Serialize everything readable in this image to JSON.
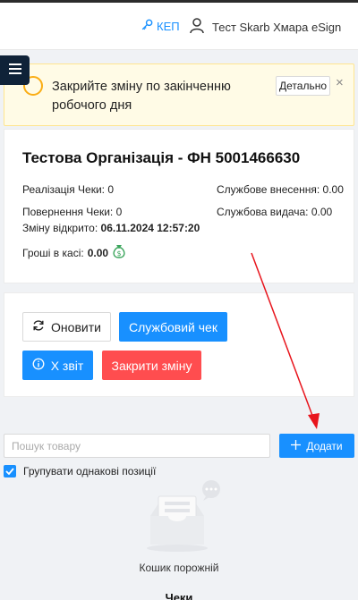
{
  "header": {
    "kep_label": "КЕП",
    "user_name": "Тест Skarb Хмара eSign"
  },
  "alert": {
    "message": "Закрийте зміну по закінченню робочого дня",
    "details_label": "Детально",
    "close_symbol": "×"
  },
  "shift": {
    "title": "Тестова Організація - ФН 5001466630",
    "sales_label": "Реалізація Чеки: 0",
    "returns_label": "Повернення Чеки: 0",
    "service_in_label": "Службове внесення: 0.00",
    "service_out_label": "Службова видача: 0.00",
    "opened_label": "Зміну відкрито:",
    "opened_value": "06.11.2024 12:57:20",
    "cash_label": "Гроші в касі:",
    "cash_value": "0.00"
  },
  "actions": {
    "refresh_label": "Оновити",
    "service_check_label": "Службовий чек",
    "x_report_label": "X звіт",
    "close_shift_label": "Закрити зміну"
  },
  "cart": {
    "search_placeholder": "Пошук товару",
    "add_label": "Додати",
    "group_label": "Групувати однакові позиції",
    "empty_label": "Кошик порожній",
    "bottom_label": "Чеки"
  },
  "colors": {
    "primary": "#1890ff",
    "danger": "#ff4d4f",
    "warning_bg": "#fffbe6",
    "nav_dark": "#0f2238"
  }
}
